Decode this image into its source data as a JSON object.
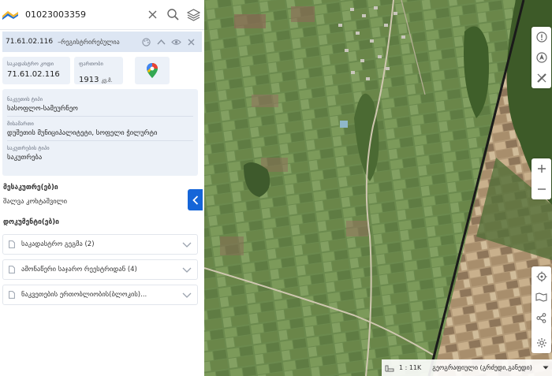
{
  "search": {
    "value": "01023003359",
    "clear_icon": "close-icon",
    "search_icon": "search-icon",
    "layers_icon": "layers-icon"
  },
  "parcel": {
    "code": "71.61.02.116",
    "status": "–რეგისტრირებულია",
    "cadastral_code_label": "საკადასტრო კოდი",
    "cadastral_code": "71.61.02.116",
    "area_label": "ფართობი",
    "area_value": "1913",
    "area_unit": "კვ.მ.",
    "property_type_label": "ნაკვეთის ტიპი",
    "property_type": "სასოფლო-სამეურნეო",
    "address_label": "მისამართი",
    "address": "დუშეთის მუნიციპალიტეტი, სოფელი ჭილურტი",
    "ownership_type_label": "საკუთრების ტიპი",
    "ownership_type": "საკუთრება"
  },
  "owners": {
    "title": "მესაკუთრე(ებ)ი",
    "name": "შალვა კოხტაშვილი"
  },
  "documents": {
    "title": "დოკუმენტი(ებ)ი",
    "items": [
      {
        "label": "საკადასტრო გეგმა (2)"
      },
      {
        "label": "ამონაწერი საჯარო რეესტრიდან (4)"
      },
      {
        "label": "ნაკვეთების ერთობლიობის(ბლოკის)..."
      }
    ]
  },
  "map": {
    "scale": "1 : 11K",
    "layer": "გეოგრაფიული (გრძედი,განედი)"
  },
  "colors": {
    "accent": "#1565d8",
    "panel_bg": "#ecf1f8",
    "header_bg": "#dde6f3"
  }
}
